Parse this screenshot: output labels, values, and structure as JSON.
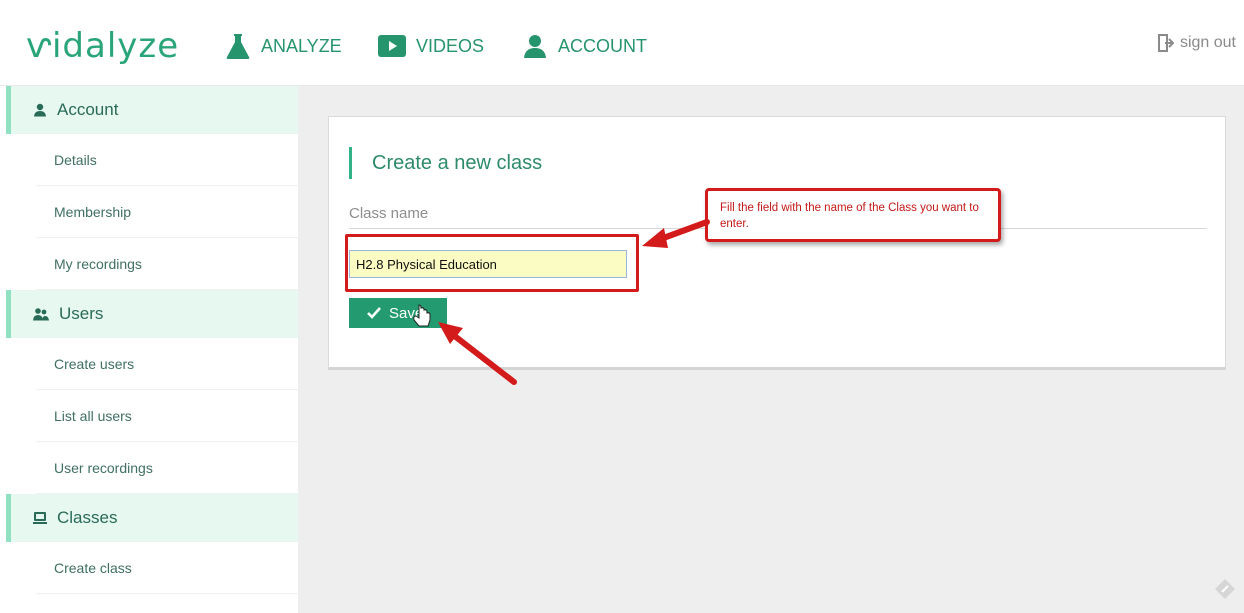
{
  "app": {
    "logo": "ⱱidalyze"
  },
  "nav": {
    "analyze": "ANALYZE",
    "videos": "VIDEOS",
    "account": "ACCOUNT",
    "signout": "sign out"
  },
  "sidebar": {
    "sections": [
      {
        "label": "Account",
        "icon": "user-icon",
        "items": [
          "Details",
          "Membership",
          "My recordings"
        ]
      },
      {
        "label": "Users",
        "icon": "users-icon",
        "items": [
          "Create users",
          "List all users",
          "User recordings"
        ]
      },
      {
        "label": "Classes",
        "icon": "classes-icon",
        "items": [
          "Create class"
        ]
      }
    ]
  },
  "form": {
    "title": "Create a new class",
    "field_label": "Class name",
    "class_name_value": "H2.8 Physical Education",
    "save_label": "Save"
  },
  "annotation": {
    "callout_text": "Fill the field with the name of the Class you want to enter."
  },
  "colors": {
    "brand": "#2aa57a",
    "save_button": "#239a6f",
    "annotation_red": "#d31b1b",
    "input_highlight": "#fbfcc3"
  }
}
